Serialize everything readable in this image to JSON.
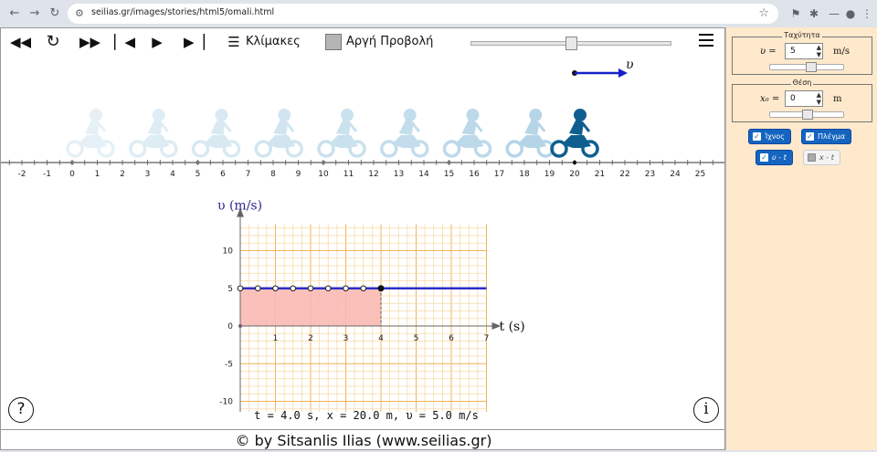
{
  "browser": {
    "url": "seilias.gr/images/stories/html5/omali.html"
  },
  "toolbar": {
    "scales_label": "Κλίμακες",
    "slow_label": "Αργή Προβολή",
    "slider_value_fraction": 0.5
  },
  "ruler": {
    "ticks": [
      "-2",
      "-1",
      "0",
      "1",
      "2",
      "3",
      "4",
      "5",
      "6",
      "7",
      "8",
      "9",
      "10",
      "11",
      "12",
      "13",
      "14",
      "15",
      "16",
      "17",
      "18",
      "19",
      "20",
      "21",
      "22",
      "23",
      "24",
      "25"
    ],
    "vector_label": "υ"
  },
  "graph": {
    "y_title": "υ (m/s)",
    "x_title": "t (s)",
    "x_ticks": [
      "1",
      "2",
      "3",
      "4",
      "5",
      "6",
      "7"
    ],
    "y_ticks": [
      "10",
      "5",
      "0",
      "-5",
      "-10"
    ]
  },
  "chart_data": {
    "type": "line",
    "title": "",
    "xlabel": "t (s)",
    "ylabel": "υ (m/s)",
    "xlim": [
      0,
      7
    ],
    "ylim": [
      -13.5,
      13.5
    ],
    "grid": true,
    "series": [
      {
        "x": [
          0,
          7
        ],
        "y": [
          5,
          5
        ]
      }
    ],
    "sample_points": {
      "x": [
        0,
        0.5,
        1,
        1.5,
        2,
        2.5,
        3,
        3.5,
        4
      ],
      "y": [
        5,
        5,
        5,
        5,
        5,
        5,
        5,
        5,
        5
      ]
    },
    "current_point": {
      "x": 4,
      "y": 5
    },
    "shaded_area": {
      "x_from": 0,
      "x_to": 4,
      "y": 5,
      "color": "#f9b6b0"
    },
    "line_color": "#2d2dc8"
  },
  "readout": "t = 4.0 s,  x = 20.0 m,  υ = 5.0 m/s",
  "footer": "© by Sitsanlis Ilias (www.seilias.gr)",
  "help_button": "?",
  "info_button": "i",
  "side": {
    "velocity": {
      "title": "Ταχύτητα",
      "symbol": "υ =",
      "value": "5",
      "unit": "m/s",
      "slider_fraction": 0.55
    },
    "position": {
      "title": "Θέση",
      "symbol": "x₀ =",
      "value": "0",
      "unit": "m",
      "slider_fraction": 0.5
    },
    "toggles": {
      "trace": "Ίχνος",
      "grid": "Πλέγμα",
      "vt": "υ - t",
      "xt": "x - t"
    }
  },
  "colors": {
    "bike_current": "#0e5f8f",
    "bike_ghost": "#9cc7e0",
    "vector": "#1520c9",
    "accent": "#1565c0"
  }
}
